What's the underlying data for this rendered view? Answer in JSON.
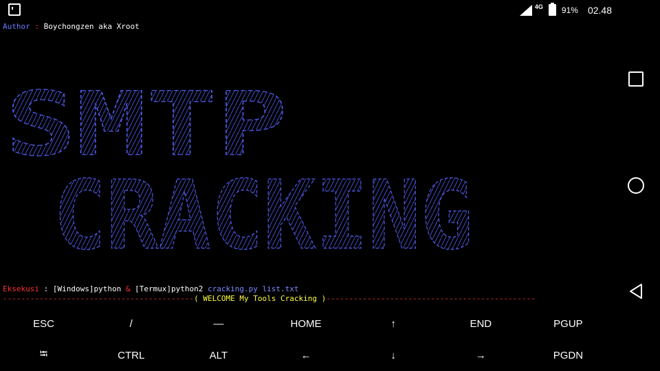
{
  "status_bar": {
    "network_type": "4G",
    "battery_percent": "91%",
    "time": "02.48"
  },
  "terminal": {
    "author": {
      "label": "Author",
      "separator": " : ",
      "value": "Boychongzen aka Xroot"
    },
    "banner_words": [
      "SMTP",
      "CRACKING"
    ],
    "exec": {
      "label": "Eksekusi",
      "separator": " : ",
      "part1": "[Windows]python ",
      "amp": "&",
      "part2": " [Termux]python2 ",
      "script": "cracking.py list.txt"
    },
    "divider": {
      "left": "------------------------------------------",
      "open": "( ",
      "text": "WELCOME My Tools Cracking",
      "close": " )",
      "right": "----------------------------------------------"
    }
  },
  "extra_keys": {
    "row1": [
      "ESC",
      "/",
      "—",
      "HOME",
      "↑",
      "END",
      "PGUP"
    ],
    "row2": [
      "⭾",
      "CTRL",
      "ALT",
      "←",
      "↓",
      "→",
      "PGDN"
    ]
  },
  "colors": {
    "background": "#000000",
    "banner": "#4a55d8",
    "author_label": "#6a7cff",
    "exec_label": "#ff3030",
    "divider": "#ff3030",
    "divider_text": "#ffff44",
    "script_name": "#7b8cff"
  }
}
